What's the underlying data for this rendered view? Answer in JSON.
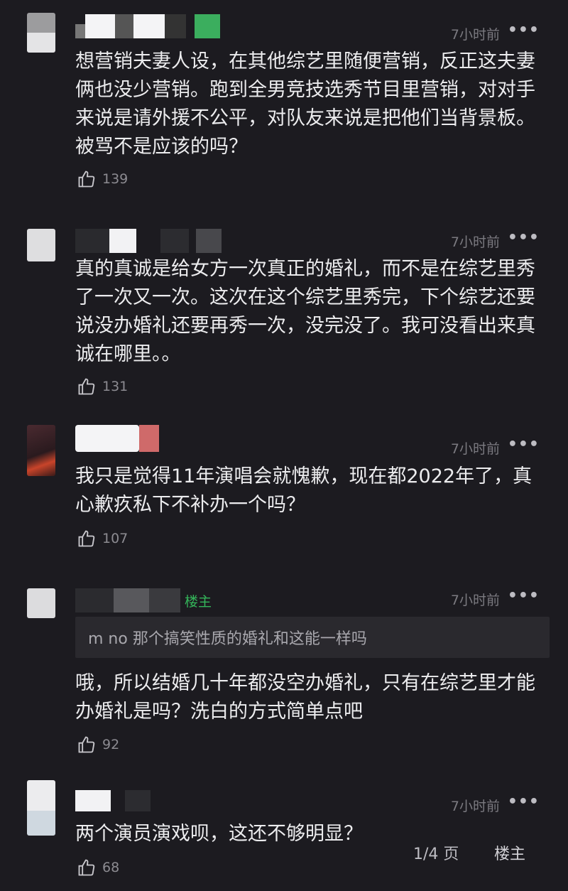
{
  "comments": [
    {
      "time": "7小时前",
      "more": "•••",
      "text": "想营销夫妻人设，在其他综艺里随便营销，反正这夫妻俩也没少营销。跑到全男竞技选秀节目里营销，对对手来说是请外援不公平，对队友来说是把他们当背景板。被骂不是应该的吗？",
      "likes": "139"
    },
    {
      "time": "7小时前",
      "more": "•••",
      "text": "真的真诚是给女方一次真正的婚礼，而不是在综艺里秀了一次又一次。这次在这个综艺里秀完，下个综艺还要说没办婚礼还要再秀一次，没完没了。我可没看出来真诚在哪里。。",
      "likes": "131"
    },
    {
      "time": "7小时前",
      "more": "•••",
      "text": "我只是觉得11年演唱会就愧歉，现在都2022年了，真心歉疚私下不补办一个吗？",
      "likes": "107"
    },
    {
      "time": "7小时前",
      "more": "•••",
      "owner_tag": "楼主",
      "quote": "m  no 那个搞笑性质的婚礼和这能一样吗",
      "text": "哦，所以结婚几十年都没空办婚礼，只有在综艺里才能办婚礼是吗？洗白的方式简单点吧",
      "likes": "92"
    },
    {
      "time": "7小时前",
      "more": "•••",
      "text": "两个演员演戏呗，这还不够明显？",
      "likes": "68"
    }
  ],
  "footer": {
    "pager": "1/4 页",
    "owner_button": "楼主"
  },
  "icons": {
    "like": "thumbs-up-icon",
    "more": "more-dots-icon"
  },
  "colors": {
    "background": "#1c1b20",
    "owner_tag": "#34b55a"
  }
}
